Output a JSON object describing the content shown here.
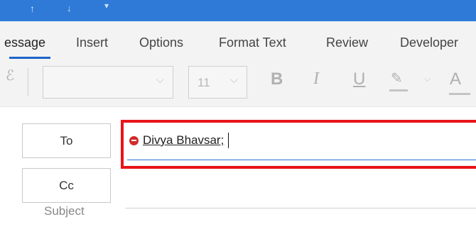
{
  "titlebar": {
    "bg_color": "#2f7ad6",
    "quick_access": [
      "arrow-up-icon",
      "arrow-down-icon",
      "customize-caret-icon"
    ]
  },
  "tabs": [
    {
      "label": "essage",
      "active": true
    },
    {
      "label": "Insert"
    },
    {
      "label": "Options"
    },
    {
      "label": "Format Text"
    },
    {
      "label": "Review"
    },
    {
      "label": "Developer"
    }
  ],
  "ribbon": {
    "font_name": "",
    "font_size": "11",
    "bold": "B",
    "italic": "I",
    "underline": "U",
    "font_color": "A",
    "icons": [
      "format-painter-icon",
      "highlighter-icon",
      "highlight-dropdown-icon",
      "font-color-icon"
    ]
  },
  "compose": {
    "to_button": "To",
    "cc_button": "Cc",
    "subject_label": "Subject",
    "to_recipients": [
      "Divya Bhavsar;"
    ],
    "cc_value": "",
    "highlight_color": "#e8141b",
    "error_icon_color": "#d12a2a"
  }
}
